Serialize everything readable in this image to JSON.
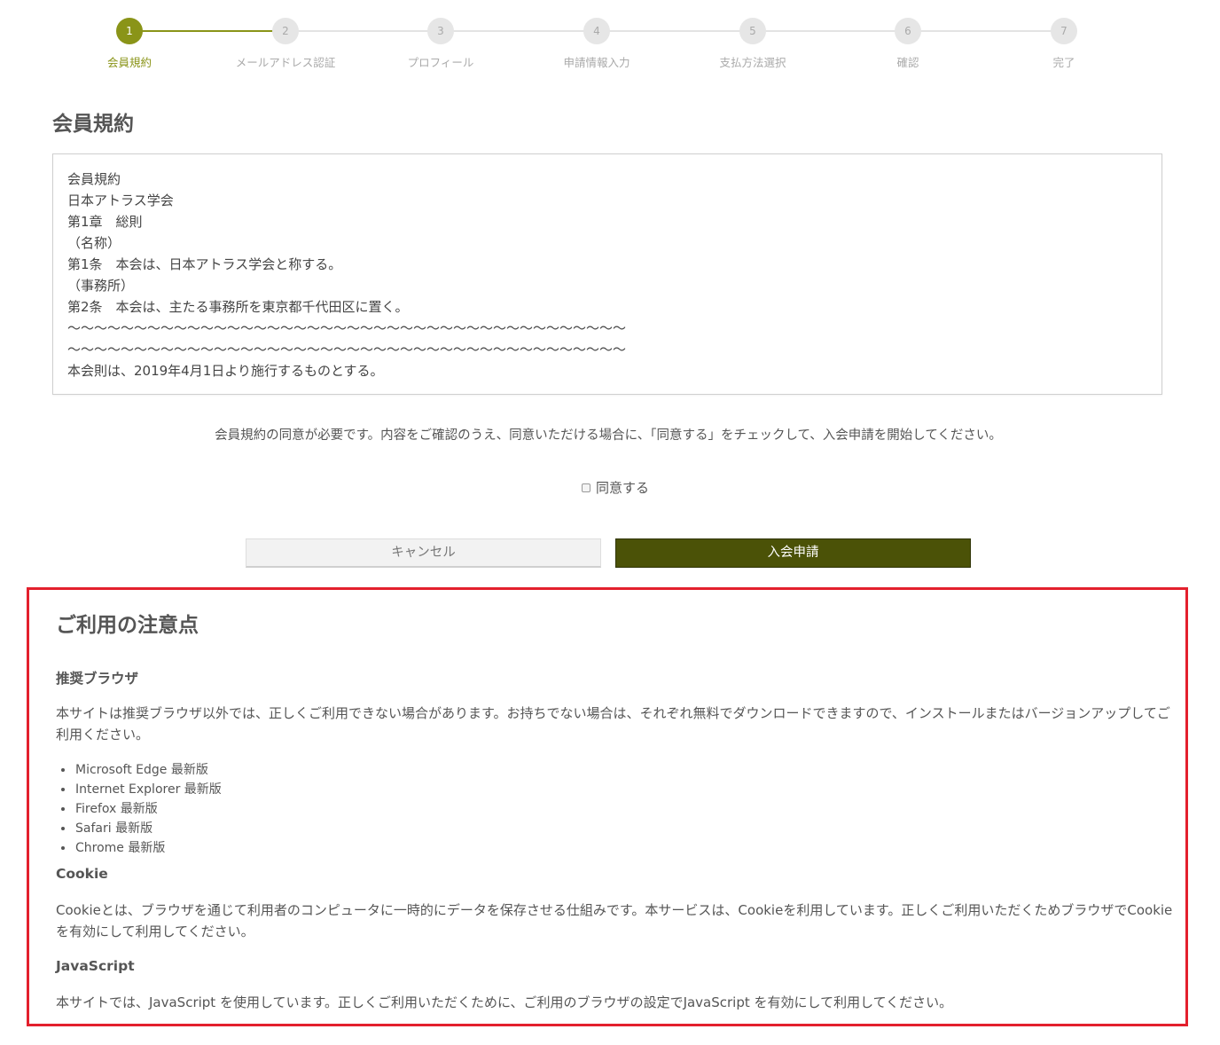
{
  "stepper": {
    "steps": [
      {
        "number": "1",
        "label": "会員規約"
      },
      {
        "number": "2",
        "label": "メールアドレス認証"
      },
      {
        "number": "3",
        "label": "プロフィール"
      },
      {
        "number": "4",
        "label": "申請情報入力"
      },
      {
        "number": "5",
        "label": "支払方法選択"
      },
      {
        "number": "6",
        "label": "確認"
      },
      {
        "number": "7",
        "label": "完了"
      }
    ],
    "current_step": 1,
    "active_color": "#8a9418"
  },
  "terms": {
    "title": "会員規約",
    "lines": [
      "会員規約",
      "日本アトラス学会",
      "第1章　総則",
      "（名称）",
      "第1条　本会は、日本アトラス学会と称する。",
      "（事務所）",
      "第2条　本会は、主たる事務所を東京都千代田区に置く。",
      "〜〜〜〜〜〜〜〜〜〜〜〜〜〜〜〜〜〜〜〜〜〜〜〜〜〜〜〜〜〜〜〜〜〜〜〜〜〜〜〜〜〜",
      "〜〜〜〜〜〜〜〜〜〜〜〜〜〜〜〜〜〜〜〜〜〜〜〜〜〜〜〜〜〜〜〜〜〜〜〜〜〜〜〜〜〜",
      "本会則は、2019年4月1日より施行するものとする。"
    ],
    "notice": "会員規約の同意が必要です。内容をご確認のうえ、同意いただける場合に、「同意する」をチェックして、入会申請を開始してください。",
    "agree_label": "同意する",
    "agree_checked": false,
    "cancel_label": "キャンセル",
    "apply_label": "入会申請",
    "apply_color": "#4b5207"
  },
  "notes": {
    "title": "ご利用の注意点",
    "highlight_color": "#e3202d",
    "browser_heading": "推奨ブラウザ",
    "browser_text": "本サイトは推奨ブラウザ以外では、正しくご利用できない場合があります。お持ちでない場合は、それぞれ無料でダウンロードできますので、インストールまたはバージョンアップしてご利用ください。",
    "browsers": [
      "Microsoft Edge 最新版",
      "Internet Explorer 最新版",
      "Firefox 最新版",
      "Safari 最新版",
      "Chrome 最新版"
    ],
    "cookie_heading": "Cookie",
    "cookie_text": "Cookieとは、ブラウザを通じて利用者のコンピュータに一時的にデータを保存させる仕組みです。本サービスは、Cookieを利用しています。正しくご利用いただくためブラウザでCookieを有効にして利用してください。",
    "js_heading": "JavaScript",
    "js_text": "本サイトでは、JavaScript を使用しています。正しくご利用いただくために、ご利用のブラウザの設定でJavaScript を有効にして利用してください。"
  }
}
